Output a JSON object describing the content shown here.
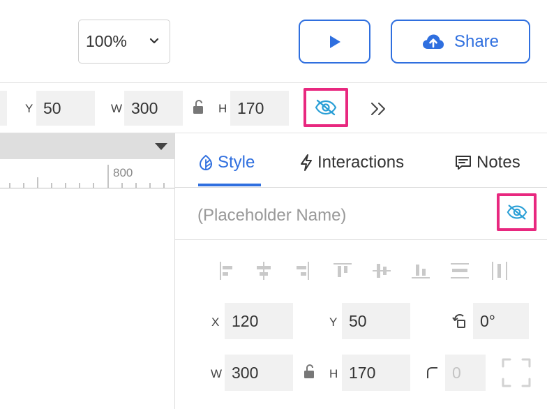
{
  "toolbar": {
    "zoom_value": "100%",
    "share_label": "Share"
  },
  "props_bar": {
    "y_label": "Y",
    "y_value": "50",
    "w_label": "W",
    "w_value": "300",
    "h_label": "H",
    "h_value": "170"
  },
  "ruler": {
    "label": "800"
  },
  "panel": {
    "tabs": [
      {
        "label": "Style",
        "active": true
      },
      {
        "label": "Interactions",
        "active": false
      },
      {
        "label": "Notes",
        "active": false
      }
    ],
    "name_placeholder": "(Placeholder Name)",
    "geometry": {
      "x_label": "X",
      "x_value": "120",
      "y_label": "Y",
      "y_value": "50",
      "rotation_value": "0°",
      "w_label": "W",
      "w_value": "300",
      "h_label": "H",
      "h_value": "170",
      "corner_placeholder": "0"
    }
  },
  "colors": {
    "accent": "#2f6fdf",
    "highlight": "#e8287f",
    "hidden_icon": "#2a9fd6"
  }
}
